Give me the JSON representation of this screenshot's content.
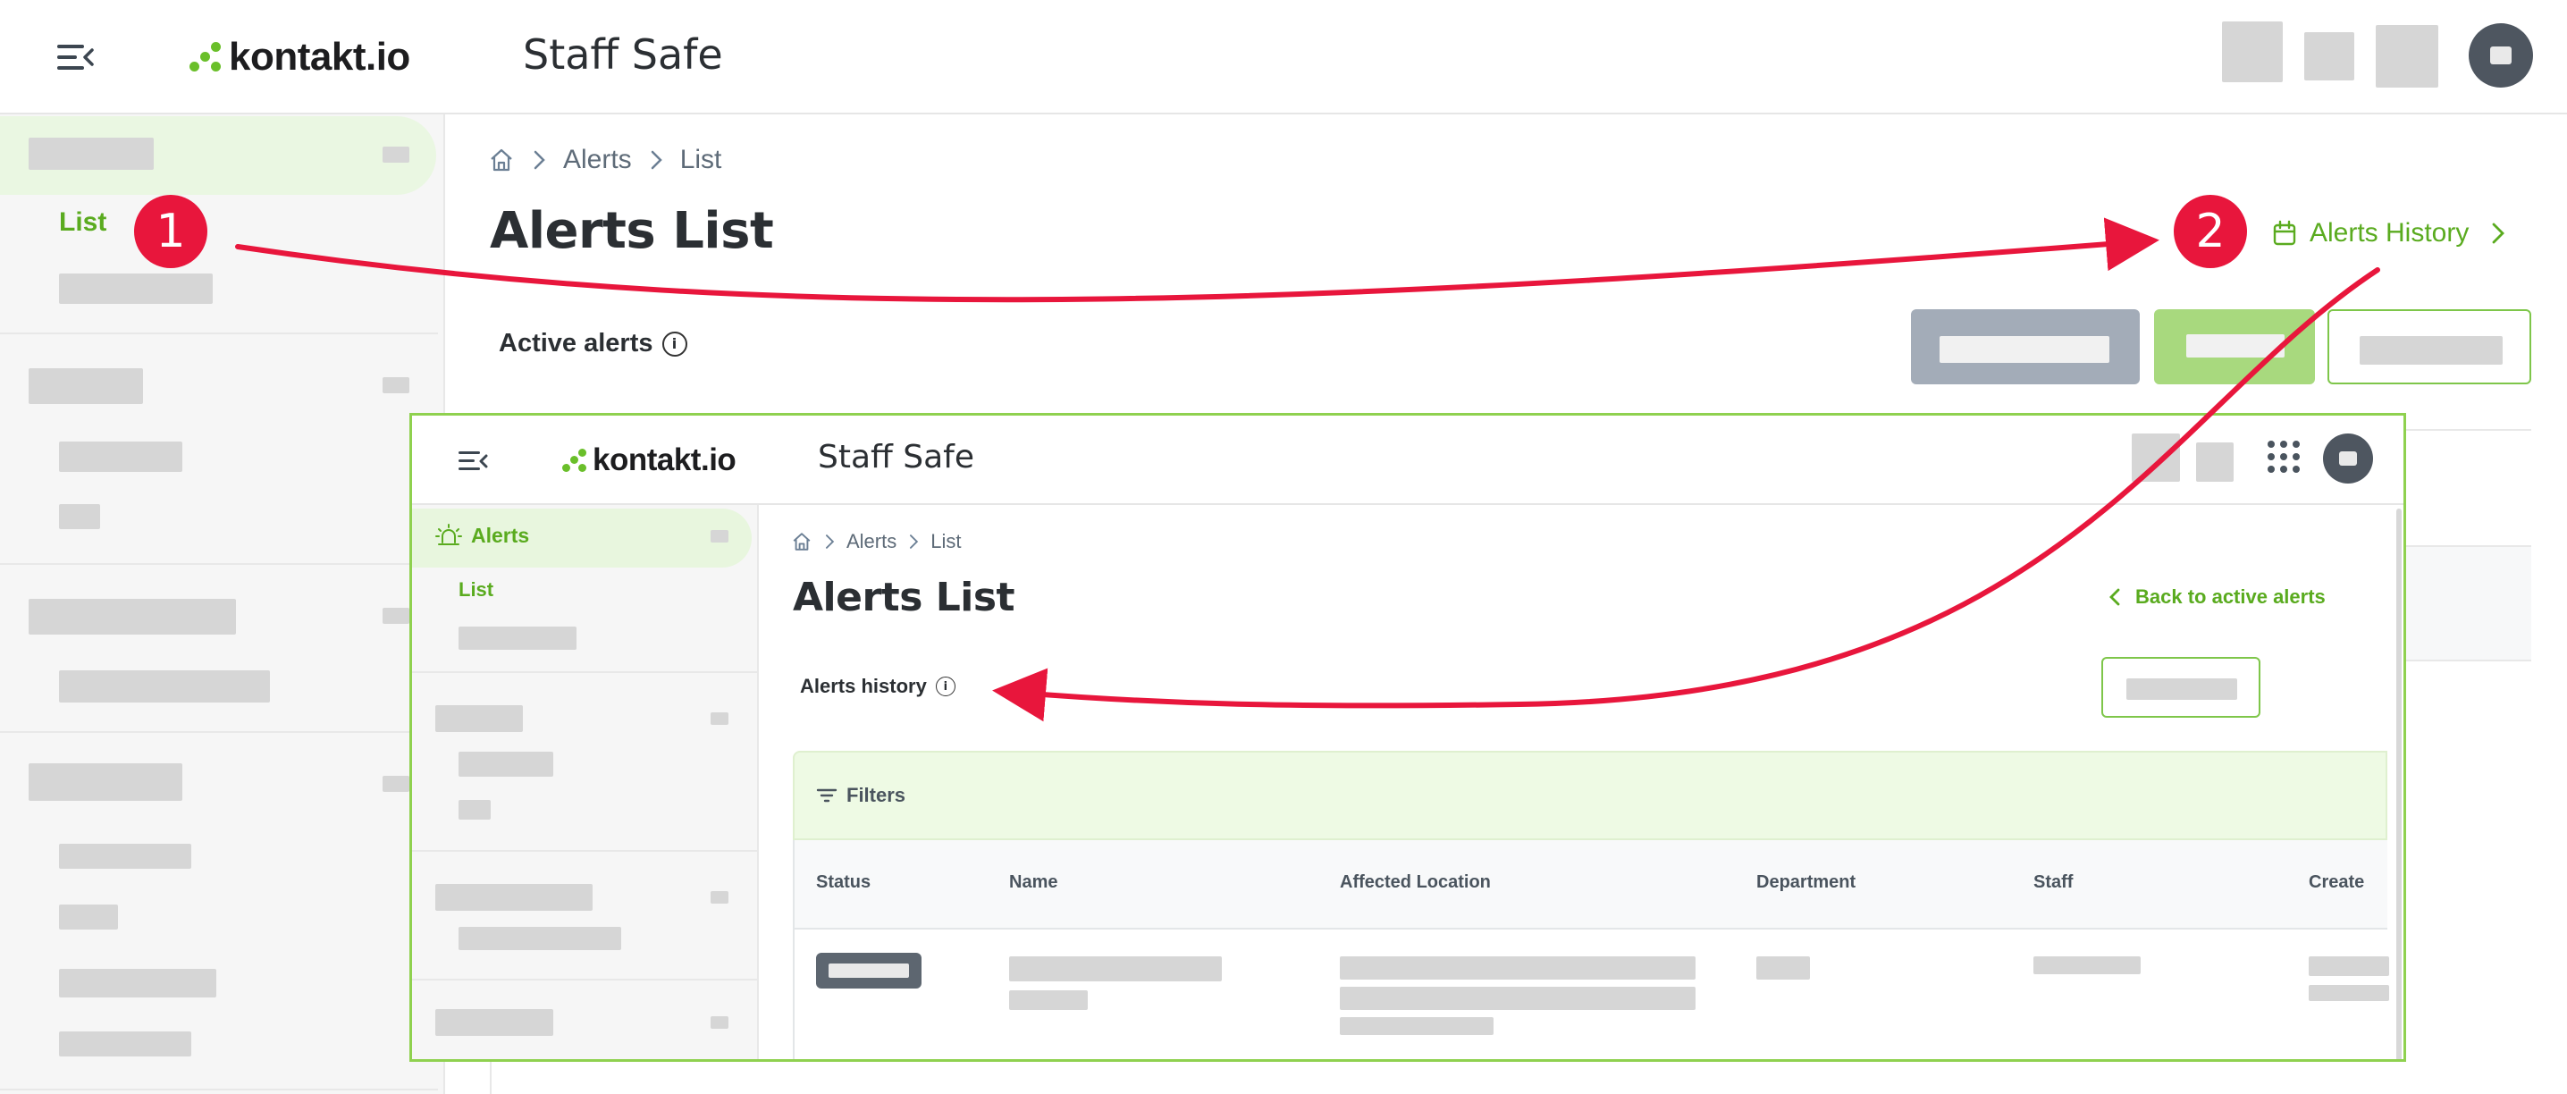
{
  "app": {
    "brand_name": "kontakt.io",
    "product_name": "Staff Safe"
  },
  "sidebar": {
    "active_item_label": "List"
  },
  "breadcrumb": {
    "items": [
      "Alerts",
      "List"
    ]
  },
  "main": {
    "page_title": "Alerts List",
    "section_title": "Active alerts",
    "history_link_label": "Alerts History"
  },
  "annotations": {
    "step1": "1",
    "step2": "2"
  },
  "inset": {
    "brand_name": "kontakt.io",
    "product_name": "Staff Safe",
    "sidebar_section_label": "Alerts",
    "sidebar_active_item_label": "List",
    "breadcrumb": [
      "Alerts",
      "List"
    ],
    "page_title": "Alerts List",
    "back_link_label": "Back to active alerts",
    "section_title": "Alerts history",
    "filters_label": "Filters",
    "table_headers": [
      "Status",
      "Name",
      "Affected Location",
      "Department",
      "Staff",
      "Create"
    ]
  },
  "icons": {
    "menu": "menu-collapse-icon",
    "home": "home-icon",
    "chevron": "chevron-right-icon",
    "calendar": "calendar-icon",
    "info": "info-icon",
    "alarm": "alarm-icon",
    "filter": "filter-icon",
    "apps": "apps-grid-icon"
  },
  "colors": {
    "accent_green": "#5aab1f",
    "active_bg": "#eaf7e2",
    "annotation_red": "#e8163c",
    "inset_border": "#8fd14f"
  }
}
